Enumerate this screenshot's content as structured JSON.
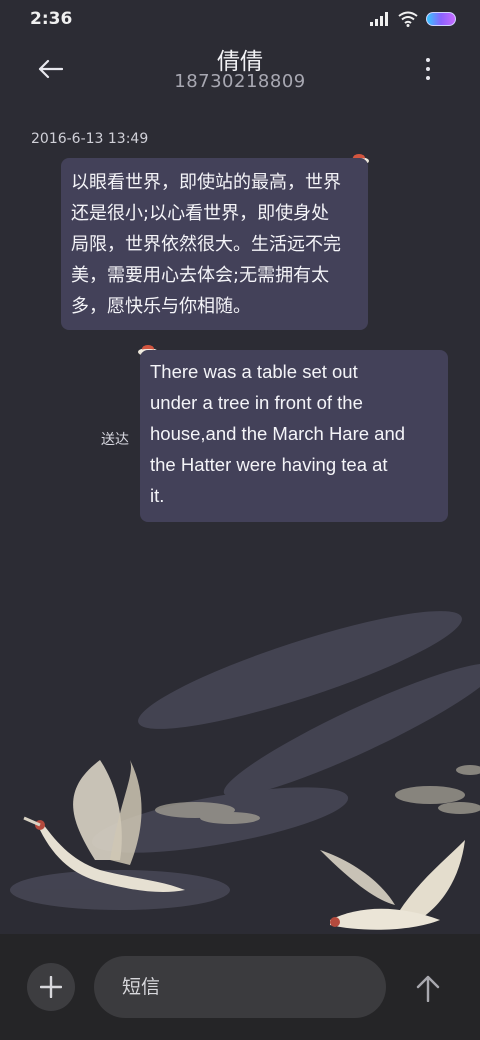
{
  "status_bar": {
    "time": "2:36",
    "icons": [
      "signal-icon",
      "wifi-icon",
      "battery-icon"
    ]
  },
  "header": {
    "contact_name": "倩倩",
    "contact_number": "18730218809",
    "back_icon": "back-arrow-icon",
    "more_icon": "more-vertical-icon"
  },
  "conversation": {
    "timestamp": "2016-6-13 13:49",
    "messages": [
      {
        "direction": "incoming",
        "lines": [
          "以眼看世界，即使站的最高，世界",
          "还是很小;以心看世界，即使身处",
          "局限，世界依然很大。生活远不完",
          "美，需要用心去体会;无需拥有太",
          "多，愿快乐与你相随。"
        ]
      },
      {
        "direction": "outgoing",
        "status": "送达",
        "lines": [
          "There was a table set out",
          "under a tree in front of the",
          "house,and the March Hare and",
          "the Hatter were having tea at",
          "it."
        ]
      }
    ]
  },
  "composer": {
    "placeholder": "短信",
    "add_icon": "plus-icon",
    "send_icon": "arrow-up-icon"
  },
  "colors": {
    "background": "#2c2c34",
    "bubble": "#434159",
    "bottom_bar": "#252527",
    "input": "#3b3b3e"
  }
}
